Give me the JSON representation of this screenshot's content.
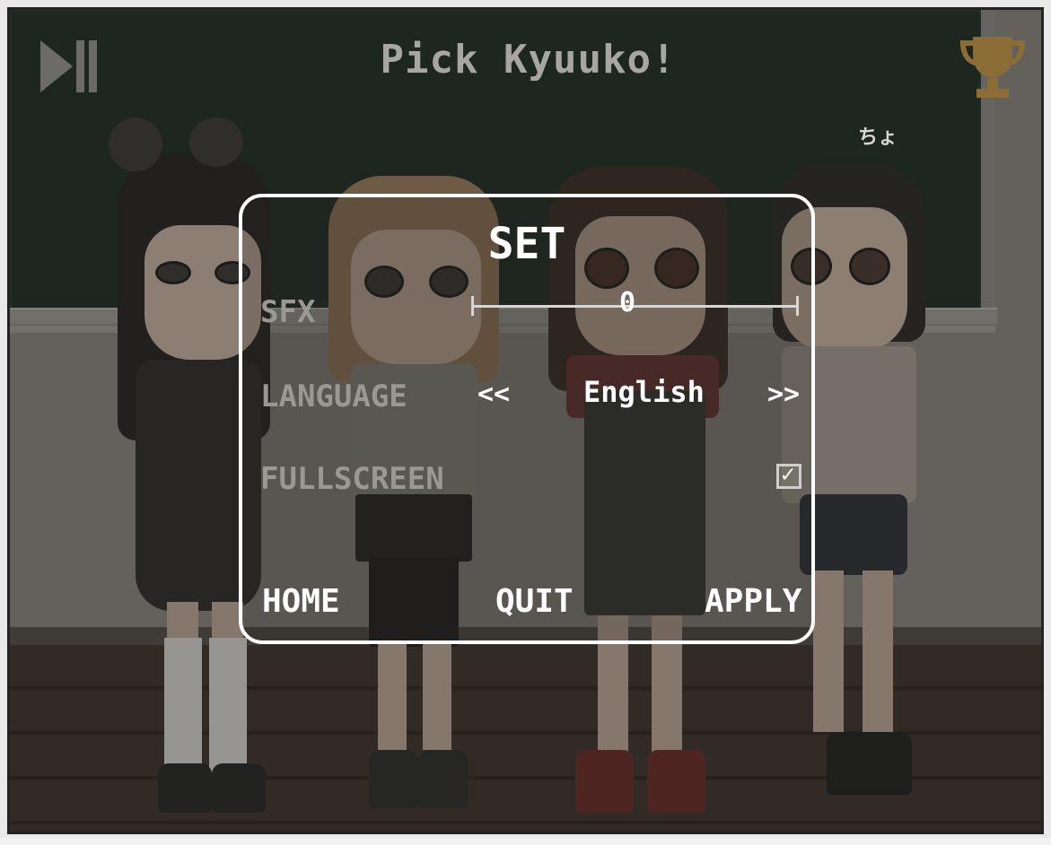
{
  "hud": {
    "title": "Pick Kyuuko!",
    "corner_text": "ちょ",
    "play_pause_icon": "play-pause-icon",
    "trophy_icon": "trophy-icon",
    "trophy_color": "#9c7a3a"
  },
  "settings": {
    "title": "SET",
    "sfx": {
      "label": "SFX",
      "value": "0"
    },
    "language": {
      "label": "LANGUAGE",
      "prev": "<<",
      "value": "English",
      "next": ">>"
    },
    "fullscreen": {
      "label": "FULLSCREEN",
      "checked": true,
      "check_glyph": "✓"
    },
    "buttons": {
      "home": "HOME",
      "quit": "QUIT",
      "apply": "APPLY"
    }
  },
  "colors": {
    "panel_border": "#ffffff",
    "label_dim": "#9b9894",
    "chalkboard": "#1e2d22"
  }
}
